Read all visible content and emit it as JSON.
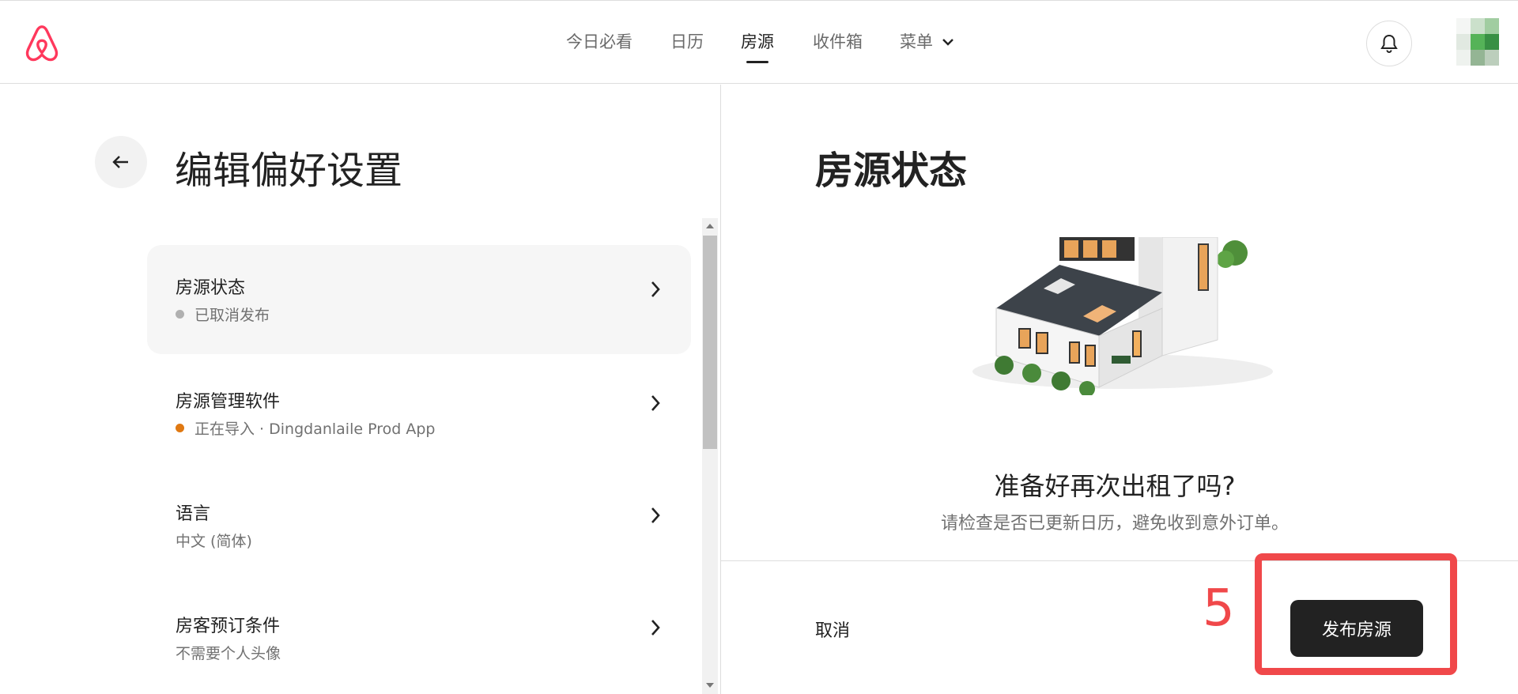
{
  "header": {
    "nav": [
      {
        "label": "今日必看"
      },
      {
        "label": "日历"
      },
      {
        "label": "房源"
      },
      {
        "label": "收件箱"
      },
      {
        "label": "菜单"
      }
    ],
    "active_nav": "房源"
  },
  "left": {
    "title": "编辑偏好设置",
    "items": [
      {
        "title": "房源状态",
        "subtitle": "已取消发布",
        "status_color": "#b0b0b0"
      },
      {
        "title": "房源管理软件",
        "subtitle": "正在导入 · Dingdanlaile Prod App",
        "status_color": "#e07912"
      },
      {
        "title": "语言",
        "subtitle": "中文 (简体)"
      },
      {
        "title": "房客预订条件",
        "subtitle": "不需要个人头像"
      }
    ]
  },
  "right": {
    "title": "房源状态",
    "prompt": "准备好再次出租了吗?",
    "description": "请检查是否已更新日历，避免收到意外订单。",
    "cancel_label": "取消",
    "publish_label": "发布房源",
    "annotation_number": "5"
  },
  "colors": {
    "brand": "#ff385c",
    "annotation": "#f0484a"
  }
}
